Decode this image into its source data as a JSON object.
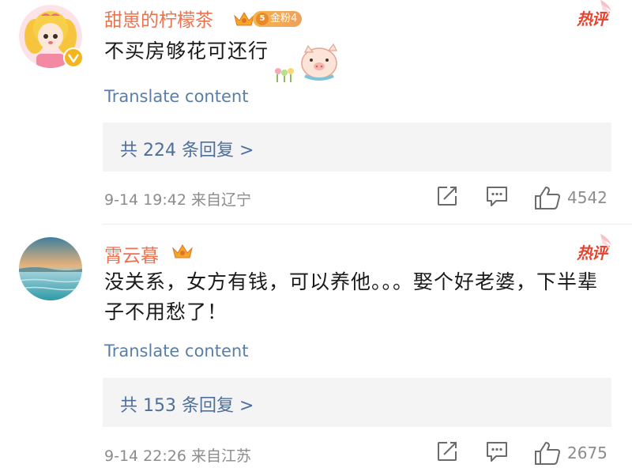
{
  "comments": [
    {
      "username": "甜崽的柠檬茶",
      "fan_badge": "金粉4",
      "fan_level": "5",
      "hot_label": "热评",
      "text": "不买房够花可还行",
      "translate": "Translate content",
      "replies": "共 224 条回复 >",
      "meta": "9-14 19:42  来自辽宁",
      "likes": "4542",
      "verified": true
    },
    {
      "username": "霄云暮",
      "hot_label": "热评",
      "text": "没关系，女方有钱，可以养他。。。娶个好老婆，下半辈子不用愁了！",
      "translate": "Translate content",
      "replies": "共 153 条回复 >",
      "meta": "9-14 22:26  来自江苏",
      "likes": "2675",
      "verified": false
    }
  ],
  "colors": {
    "username": "#eb7350",
    "link": "#5a7ea6",
    "reply_text": "#4e6f9b",
    "meta": "#8c8c8c",
    "hot": "#e8432f",
    "reply_bg": "#f4f4f4"
  },
  "icons": [
    "avatar-cartoon-girl",
    "verified-v-icon",
    "crown-icon",
    "hot-comment-icon",
    "pig-sticker",
    "share-icon",
    "comment-icon",
    "like-icon",
    "avatar-seascape"
  ]
}
